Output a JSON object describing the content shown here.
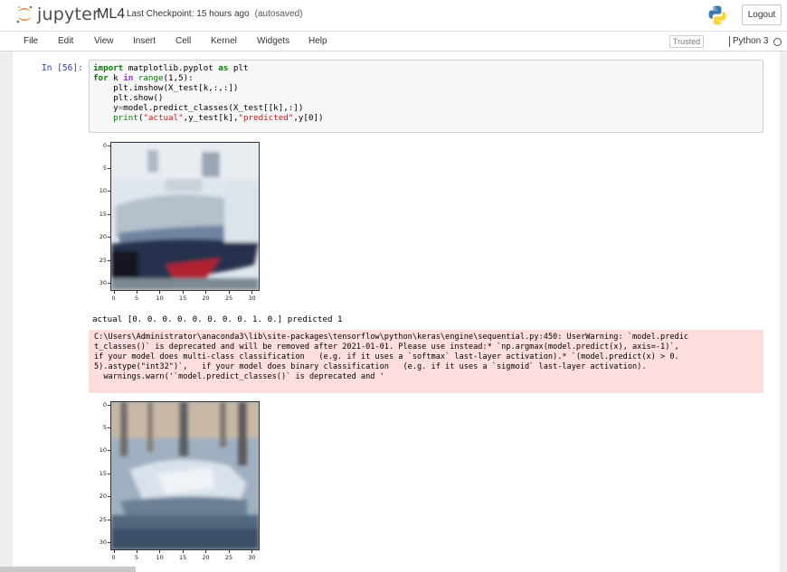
{
  "header": {
    "logo_text": "jupyter",
    "notebook_name": "ML4",
    "checkpoint": "Last Checkpoint: 15 hours ago",
    "autosave": "(autosaved)",
    "logout": "Logout"
  },
  "menubar": {
    "items": [
      "File",
      "Edit",
      "View",
      "Insert",
      "Cell",
      "Kernel",
      "Widgets",
      "Help"
    ],
    "trusted": "Trusted",
    "kernel": "Python 3"
  },
  "cell": {
    "prompt": "In [56]:",
    "code_lines": [
      "import matplotlib.pyplot as plt",
      "for k in range(1,5):",
      "    plt.imshow(X_test[k,:,:])",
      "    plt.show()",
      "    y=model.predict_classes(X_test[[k],:])",
      "    print(\"actual\",y_test[k],\"predicted\",y[0])"
    ]
  },
  "output": {
    "stdout_1": "actual [0. 0. 0. 0. 0. 0. 0. 0. 1. 0.] predicted 1",
    "stderr_lines": [
      "C:\\Users\\Administrator\\anaconda3\\lib\\site-packages\\tensorflow\\python\\keras\\engine\\sequential.py:450: UserWarning: `model.predic",
      "t_classes()` is deprecated and will be removed after 2021-01-01. Please use instead:* `np.argmax(model.predict(x), axis=-1)`,",
      "if your model does multi-class classification   (e.g. if it uses a `softmax` last-layer activation).* `(model.predict(x) > 0.",
      "5).astype(\"int32\")`,   if your model does binary classification   (e.g. if it uses a `sigmoid` last-layer activation).",
      "  warnings.warn('`model.predict_classes()` is deprecated and '"
    ],
    "plot_ticks": {
      "x": [
        "0",
        "5",
        "10",
        "15",
        "20",
        "25",
        "30"
      ],
      "y": [
        "0",
        "5",
        "10",
        "15",
        "20",
        "25",
        "30"
      ]
    }
  },
  "colors": {
    "prompt": "#303f9f",
    "keyword": "#008000",
    "string": "#ba2121",
    "stderr_bg": "#fddddd",
    "jupyter_orange": "#f37726"
  }
}
